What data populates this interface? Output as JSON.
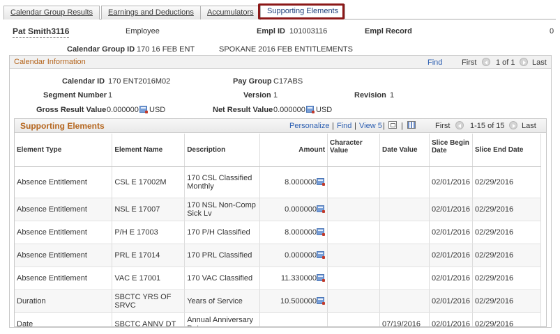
{
  "tabs": [
    {
      "label": "Calendar Group Results",
      "active": false
    },
    {
      "label": "Earnings and Deductions",
      "active": false
    },
    {
      "label": "Accumulators",
      "active": false
    },
    {
      "label": "Supporting Elements",
      "active": true
    }
  ],
  "header": {
    "name": "Pat Smith3116",
    "role": "Employee",
    "empl_id_label": "Empl ID",
    "empl_id": "101003116",
    "empl_record_label": "Empl Record",
    "empl_record": "0",
    "cal_group_label": "Calendar Group ID",
    "cal_group_id": "170 16 FEB ENT",
    "cal_group_desc": "SPOKANE 2016 FEB ENTITLEMENTS"
  },
  "cal_info": {
    "title": "Calendar Information",
    "find": "Find",
    "first": "First",
    "range": "1 of 1",
    "last": "Last",
    "calendar_id_label": "Calendar ID",
    "calendar_id": "170 ENT2016M02",
    "pay_group_label": "Pay Group",
    "pay_group": "C17ABS",
    "segment_label": "Segment Number",
    "segment": "1",
    "version_label": "Version",
    "version": "1",
    "revision_label": "Revision",
    "revision": "1",
    "gross_label": "Gross Result Value",
    "gross_value": "0.000000",
    "gross_currency": "USD",
    "net_label": "Net Result Value",
    "net_value": "0.000000",
    "net_currency": "USD"
  },
  "supporting": {
    "title": "Supporting Elements",
    "personalize": "Personalize",
    "find": "Find",
    "view": "View 5",
    "first": "First",
    "range": "1-15 of 15",
    "last": "Last",
    "columns": [
      "Element Type",
      "Element Name",
      "Description",
      "Amount",
      "Character Value",
      "Date Value",
      "Slice Begin Date",
      "Slice End Date"
    ],
    "rows": [
      {
        "type": "Absence Entitlement",
        "name": "CSL E 17002M",
        "desc": "170 CSL Classified Monthly",
        "amount": "8.000000",
        "char": "",
        "date": "",
        "begin": "02/01/2016",
        "end": "02/29/2016"
      },
      {
        "type": "Absence Entitlement",
        "name": "NSL E 17007",
        "desc": "170 NSL Non-Comp Sick Lv",
        "amount": "0.000000",
        "char": "",
        "date": "",
        "begin": "02/01/2016",
        "end": "02/29/2016"
      },
      {
        "type": "Absence Entitlement",
        "name": "P/H E 17003",
        "desc": "170 P/H Classified",
        "amount": "8.000000",
        "char": "",
        "date": "",
        "begin": "02/01/2016",
        "end": "02/29/2016"
      },
      {
        "type": "Absence Entitlement",
        "name": "PRL E 17014",
        "desc": "170 PRL Classified",
        "amount": "0.000000",
        "char": "",
        "date": "",
        "begin": "02/01/2016",
        "end": "02/29/2016"
      },
      {
        "type": "Absence Entitlement",
        "name": "VAC E 17001",
        "desc": "170 VAC Classified",
        "amount": "11.330000",
        "char": "",
        "date": "",
        "begin": "02/01/2016",
        "end": "02/29/2016"
      },
      {
        "type": "Duration",
        "name": "SBCTC YRS OF SRVC",
        "desc": "Years of Service",
        "amount": "10.500000",
        "char": "",
        "date": "",
        "begin": "02/01/2016",
        "end": "02/29/2016"
      },
      {
        "type": "Date",
        "name": "SBCTC ANNV DT",
        "desc": "Annual Anniversary Date",
        "amount": "",
        "char": "",
        "date": "07/19/2016",
        "begin": "02/01/2016",
        "end": "02/29/2016"
      }
    ]
  }
}
